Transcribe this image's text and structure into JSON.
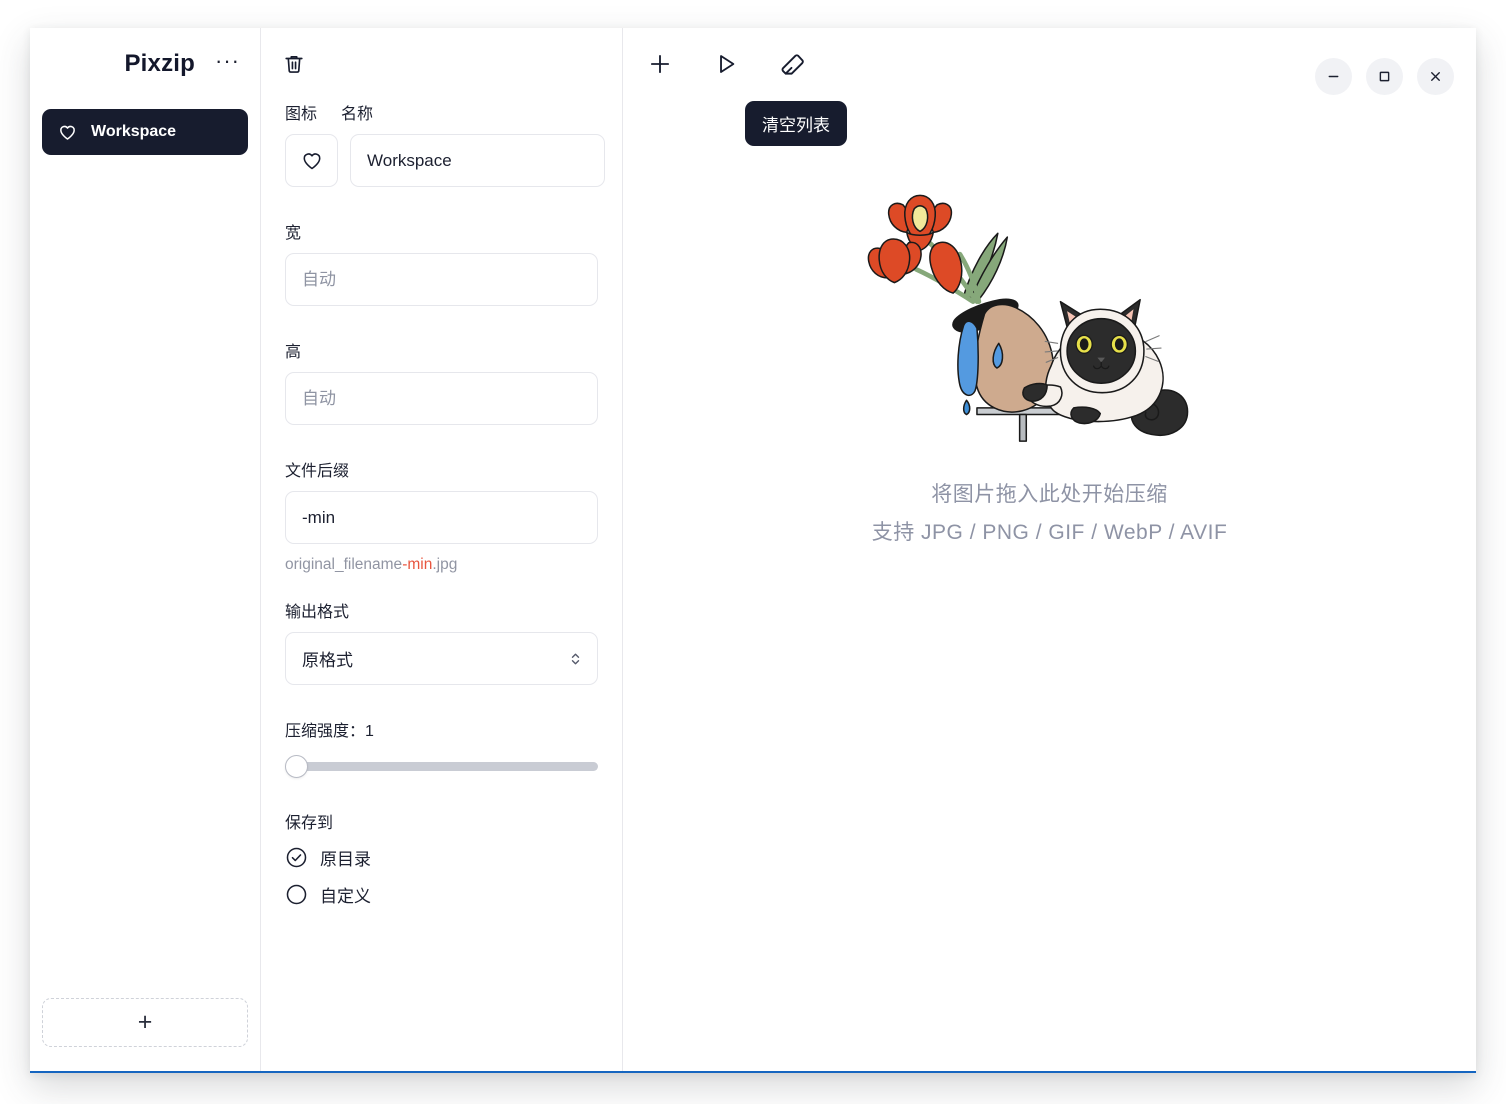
{
  "app": {
    "title": "Pixzip",
    "more_menu": "···"
  },
  "sidebar": {
    "workspace_item": {
      "label": "Workspace",
      "icon": "heart-icon",
      "selected": true
    },
    "add_button": {
      "label": "+",
      "icon": "plus-icon"
    }
  },
  "settings": {
    "delete_icon": "trash-icon",
    "icon_label": "图标",
    "name_label": "名称",
    "name_value": "Workspace",
    "icon_glyph": "heart-icon",
    "width_label": "宽",
    "width_placeholder": "自动",
    "width_value": "",
    "height_label": "高",
    "height_placeholder": "自动",
    "height_value": "",
    "suffix_label": "文件后缀",
    "suffix_value": "-min",
    "suffix_hint_prefix": "original_filename",
    "suffix_hint_highlight": "-min",
    "suffix_hint_ext": ".jpg",
    "format_label": "输出格式",
    "format_value": "原格式",
    "quality_label": "压缩强度：1",
    "quality_value": 1,
    "quality_min": 1,
    "quality_max": 10,
    "save_to_label": "保存到",
    "save_options": [
      {
        "label": "原目录",
        "selected": true
      },
      {
        "label": "自定义",
        "selected": false
      }
    ]
  },
  "toolbar": {
    "add_icon": "plus-icon",
    "start_icon": "play-icon",
    "clear_icon": "eraser-icon",
    "clear_tooltip": "清空列表"
  },
  "window_controls": {
    "minimize": "minimize-icon",
    "maximize": "maximize-icon",
    "close": "close-icon"
  },
  "dropzone": {
    "illustration": "cat-and-vase-illustration",
    "primary_text": "将图片拖入此处开始压缩",
    "secondary_text": "支持 JPG / PNG / GIF / WebP / AVIF"
  },
  "colors": {
    "accent_dark": "#171c2e",
    "highlight_red": "#e8563f",
    "muted_text": "#8e93a5",
    "window_bottom_border": "#1565c0"
  }
}
